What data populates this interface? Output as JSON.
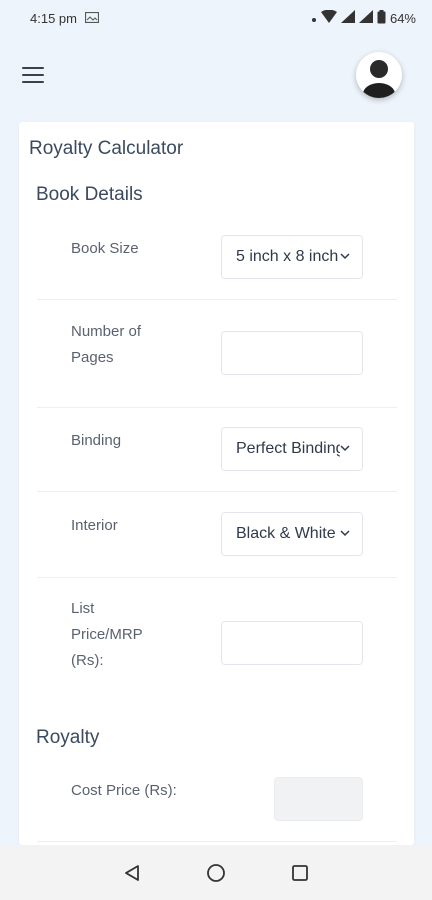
{
  "status": {
    "time": "4:15 pm",
    "battery": "64%",
    "icons": [
      "image-icon",
      "dot-icon",
      "wifi-icon",
      "signal-icon",
      "battery-icon"
    ]
  },
  "header": {
    "menu_icon": "hamburger-icon",
    "avatar_icon": "user-avatar-icon"
  },
  "card": {
    "title": "Royalty Calculator",
    "book_details": {
      "heading": "Book Details",
      "fields": [
        {
          "label": "Book Size",
          "type": "select",
          "value": "5 inch x 8 inch"
        },
        {
          "label": "Number of Pages",
          "type": "input",
          "value": ""
        },
        {
          "label": "Binding",
          "type": "select",
          "value": "Perfect Binding"
        },
        {
          "label": "Interior",
          "type": "select",
          "value": "Black & White"
        },
        {
          "label": "List Price/MRP (Rs):",
          "type": "input",
          "value": ""
        }
      ]
    },
    "royalty": {
      "heading": "Royalty",
      "fields": [
        {
          "label": "Cost Price (Rs):",
          "type": "readonly",
          "value": ""
        }
      ]
    }
  },
  "navbar": {
    "buttons": [
      "back-icon",
      "home-icon",
      "recents-icon"
    ]
  },
  "colors": {
    "page_bg": "#eef4fb",
    "card_bg": "#ffffff",
    "text_heading": "#3b4a60",
    "text_label": "#5a6270"
  }
}
